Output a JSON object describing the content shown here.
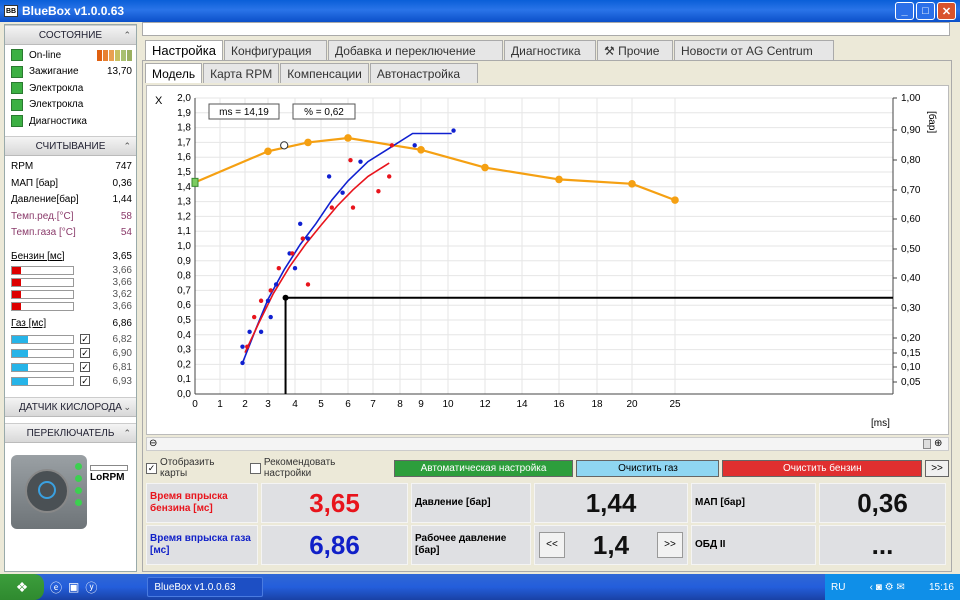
{
  "window": {
    "title": "BlueBox v1.0.0.63"
  },
  "left": {
    "state_header": "СОСТОЯНИЕ",
    "state_items": [
      {
        "label": "On-line",
        "value": ""
      },
      {
        "label": "Зажигание",
        "value": "13,70"
      },
      {
        "label": "Электрокла",
        "value": ""
      },
      {
        "label": "Электрокла",
        "value": ""
      },
      {
        "label": "Диагностика",
        "value": ""
      }
    ],
    "read_header": "СЧИТЫВАНИЕ",
    "readings": [
      {
        "label": "RPM",
        "value": "747"
      },
      {
        "label": "МАП [бар]",
        "value": "0,36"
      },
      {
        "label": "Давление[бар]",
        "value": "1,44"
      },
      {
        "label": "Темп.ред.[°C]",
        "value": "58"
      },
      {
        "label": "Темп.газа [°C]",
        "value": "54"
      }
    ],
    "petrol": {
      "label": "Бензин [мс]",
      "value": "3,65",
      "injectors": [
        "3,66",
        "3,66",
        "3,62",
        "3,66"
      ]
    },
    "gas": {
      "label": "Газ [мс]",
      "value": "6,86",
      "injectors": [
        "6,82",
        "6,90",
        "6,81",
        "6,93"
      ]
    },
    "o2_header": "ДАТЧИК КИСЛОРОДА",
    "switch_header": "ПЕРЕКЛЮЧАТЕЛЬ",
    "switch_label": "LoRPM"
  },
  "tabs": {
    "main": [
      "Настройка",
      "Конфигурация",
      "Добавка и переключение",
      "Диагностика",
      "Прочие",
      "Новости от AG Centrum"
    ],
    "sub": [
      "Модель",
      "Карта RPM",
      "Компенсации",
      "Автонастройка"
    ]
  },
  "chart_data": {
    "type": "line",
    "left_axis_label": "X",
    "right_axis_label": "[бар]",
    "x_axis_label": "[ms]",
    "xlim": [
      0,
      25
    ],
    "ylim": [
      0,
      2.0
    ],
    "y2lim": [
      0.05,
      1.0
    ],
    "x_ticks": [
      0,
      1,
      2,
      3,
      4,
      5,
      6,
      7,
      8,
      9,
      10,
      12,
      14,
      16,
      18,
      20,
      25
    ],
    "y_ticks": [
      "0,0",
      "0,1",
      "0,2",
      "0,3",
      "0,4",
      "0,5",
      "0,6",
      "0,7",
      "0,8",
      "0,9",
      "1,0",
      "1,1",
      "1,2",
      "1,3",
      "1,4",
      "1,5",
      "1,6",
      "1,7",
      "1,8",
      "1,9",
      "2,0"
    ],
    "y2_ticks": [
      "0,05",
      "0,10",
      "0,15",
      "0,20",
      "0,30",
      "0,40",
      "0,50",
      "0,60",
      "0,70",
      "0,80",
      "0,90",
      "1,00"
    ],
    "annotations": {
      "ms": "ms = 14,19",
      "pct": "% = 0,62"
    },
    "series": [
      {
        "kind": "orange-curve",
        "color": "#f5a012",
        "points": [
          [
            0,
            1.43
          ],
          [
            3,
            1.64
          ],
          [
            4.5,
            1.7
          ],
          [
            6,
            1.73
          ],
          [
            9,
            1.65
          ],
          [
            12,
            1.53
          ],
          [
            16,
            1.45
          ],
          [
            20,
            1.42
          ],
          [
            25,
            1.31
          ]
        ]
      },
      {
        "kind": "blue-line",
        "color": "#1020d0",
        "points": [
          [
            1.9,
            0.21
          ],
          [
            2.5,
            0.45
          ],
          [
            3.0,
            0.64
          ],
          [
            3.6,
            0.84
          ],
          [
            4.2,
            1.01
          ],
          [
            4.8,
            1.15
          ],
          [
            5.4,
            1.31
          ],
          [
            6.0,
            1.44
          ],
          [
            6.8,
            1.57
          ],
          [
            7.6,
            1.66
          ],
          [
            8.6,
            1.76
          ],
          [
            10.2,
            1.76
          ]
        ]
      },
      {
        "kind": "red-line",
        "color": "#e8141c",
        "points": [
          [
            2.0,
            0.28
          ],
          [
            2.6,
            0.48
          ],
          [
            3.2,
            0.68
          ],
          [
            3.8,
            0.86
          ],
          [
            4.4,
            1.01
          ],
          [
            5.0,
            1.14
          ],
          [
            5.6,
            1.27
          ],
          [
            6.2,
            1.38
          ],
          [
            6.8,
            1.47
          ],
          [
            7.6,
            1.56
          ]
        ]
      },
      {
        "kind": "blue-dots",
        "color": "#1020d0",
        "points": [
          [
            1.9,
            0.21
          ],
          [
            1.9,
            0.32
          ],
          [
            2.2,
            0.42
          ],
          [
            2.7,
            0.42
          ],
          [
            3.0,
            0.63
          ],
          [
            3.1,
            0.52
          ],
          [
            3.3,
            0.74
          ],
          [
            3.8,
            0.95
          ],
          [
            4.0,
            0.85
          ],
          [
            4.2,
            1.15
          ],
          [
            4.5,
            1.05
          ],
          [
            5.3,
            1.47
          ],
          [
            5.8,
            1.36
          ],
          [
            6.5,
            1.57
          ],
          [
            8.7,
            1.68
          ],
          [
            10.3,
            1.78
          ]
        ]
      },
      {
        "kind": "red-dots",
        "color": "#e8141c",
        "points": [
          [
            2.1,
            0.32
          ],
          [
            2.4,
            0.52
          ],
          [
            2.7,
            0.63
          ],
          [
            3.1,
            0.7
          ],
          [
            3.4,
            0.85
          ],
          [
            3.9,
            0.95
          ],
          [
            4.3,
            1.05
          ],
          [
            4.5,
            0.74
          ],
          [
            5.4,
            1.26
          ],
          [
            6.1,
            1.58
          ],
          [
            6.2,
            1.26
          ],
          [
            7.2,
            1.37
          ],
          [
            7.6,
            1.47
          ],
          [
            7.7,
            1.68
          ]
        ]
      }
    ],
    "marker": {
      "x": 3.65,
      "y": 0.65
    }
  },
  "options": {
    "show_maps": "Отобразить карты",
    "recommend": "Рекомендовать настройки",
    "auto_btn": "Автоматическая настройка",
    "clear_gas_btn": "Очистить газ",
    "clear_petrol_btn": "Очистить бензин",
    "more_btn": ">>"
  },
  "readouts": {
    "petrol_label": "Время впрыска бензина [мс]",
    "petrol_value": "3,65",
    "pressure_label": "Давление [бар]",
    "pressure_value": "1,44",
    "map_label": "МАП [бар]",
    "map_value": "0,36",
    "gas_label": "Время впрыска газа [мс]",
    "gas_value": "6,86",
    "work_pressure_label": "Рабочее давление [бар]",
    "work_pressure_value": "1,4",
    "prev_btn": "<<",
    "next_btn": ">>",
    "obd_label": "ОБД II",
    "obd_value": "..."
  },
  "taskbar": {
    "task": "BlueBox v1.0.0.63",
    "lang": "RU",
    "time": "15:16"
  }
}
